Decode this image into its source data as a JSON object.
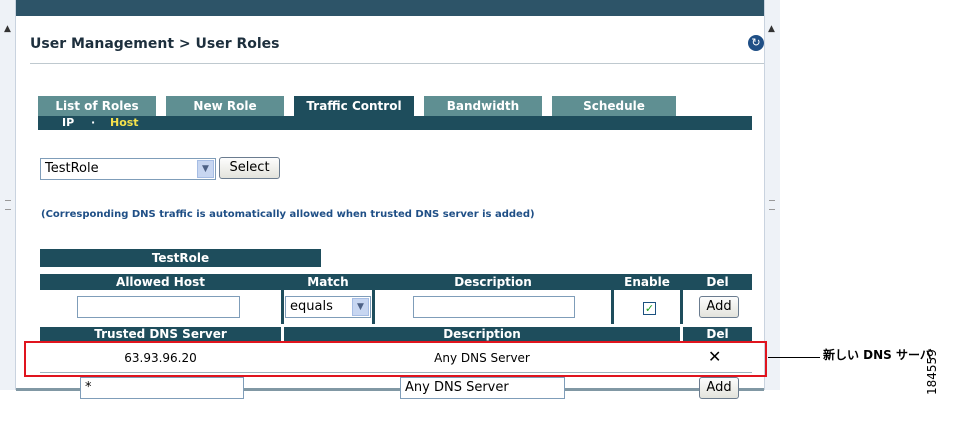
{
  "header": {
    "title": "User Management > User Roles"
  },
  "tabs": [
    {
      "label": "List of Roles",
      "active": false
    },
    {
      "label": "New Role",
      "active": false
    },
    {
      "label": "Traffic Control",
      "active": true
    },
    {
      "label": "Bandwidth",
      "active": false
    },
    {
      "label": "Schedule",
      "active": false
    }
  ],
  "subtabs": {
    "ip": "IP",
    "separator": "·",
    "host": "Host"
  },
  "role_selector": {
    "value": "TestRole",
    "button": "Select"
  },
  "info_text": "(Corresponding DNS traffic is automatically allowed when trusted DNS server is added)",
  "allowed_hosts": {
    "role_name": "TestRole",
    "columns": [
      "Allowed Host",
      "Match",
      "Description",
      "Enable",
      "Del"
    ],
    "new_row": {
      "host": "",
      "match": "equals",
      "description": "",
      "enabled": true,
      "add_button": "Add"
    }
  },
  "trusted_dns": {
    "columns": [
      "Trusted DNS Server",
      "Description",
      "Del"
    ],
    "rows": [
      {
        "server": "63.93.96.20",
        "description": "Any DNS Server"
      }
    ],
    "new_row": {
      "server": "*",
      "description": "Any DNS Server",
      "add_button": "Add"
    }
  },
  "annotation": {
    "label": "新しい DNS サーバ",
    "figure_id": "184559"
  },
  "colors": {
    "header_bg": "#1e4d5c",
    "tab_bg": "#5f8f92",
    "highlight": "#e0141e",
    "subtab_active": "#f5e14c"
  }
}
